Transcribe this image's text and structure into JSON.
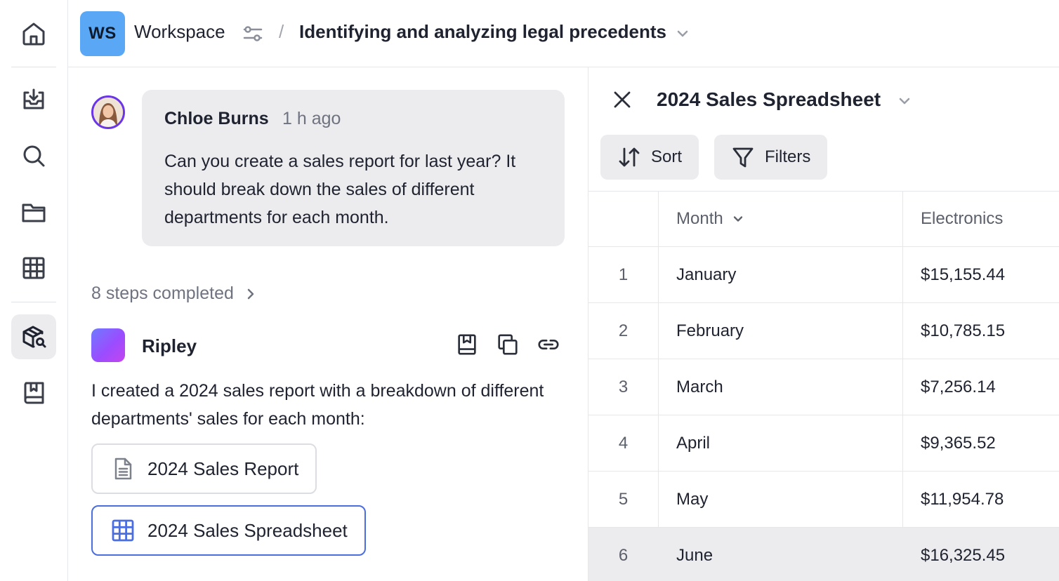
{
  "rail": {
    "items": [
      "home",
      "inbox",
      "search",
      "folders",
      "tables",
      "research",
      "library"
    ],
    "active": "research"
  },
  "topbar": {
    "workspace_badge": "WS",
    "workspace_name": "Workspace",
    "separator": "/",
    "page_title": "Identifying and analyzing legal precedents"
  },
  "chat": {
    "user_message": {
      "author": "Chloe Burns",
      "time": "1 h ago",
      "text": "Can you create a sales report for last year? It should break down the sales of different departments for each month."
    },
    "steps_label": "8 steps completed",
    "assistant": {
      "name": "Ripley",
      "text": "I created a 2024 sales report with a breakdown of different departments' sales for each month:"
    },
    "attachments": [
      {
        "label": "2024 Sales Report",
        "icon": "document-icon"
      },
      {
        "label": "2024 Sales Spreadsheet",
        "icon": "table-icon"
      }
    ]
  },
  "sheet": {
    "title": "2024 Sales Spreadsheet",
    "sort_label": "Sort",
    "filters_label": "Filters",
    "columns": [
      "",
      "Month",
      "Electronics"
    ],
    "rows": [
      {
        "idx": "1",
        "month": "January",
        "electronics": "$15,155.44"
      },
      {
        "idx": "2",
        "month": "February",
        "electronics": "$10,785.15"
      },
      {
        "idx": "3",
        "month": "March",
        "electronics": "$7,256.14"
      },
      {
        "idx": "4",
        "month": "April",
        "electronics": "$9,365.52"
      },
      {
        "idx": "5",
        "month": "May",
        "electronics": "$11,954.78"
      },
      {
        "idx": "6",
        "month": "June",
        "electronics": "$16,325.45"
      }
    ]
  },
  "colors": {
    "accent_border": "#4a6ee0",
    "badge_bg": "#5aa8f5",
    "avatar_ring": "#6b35e8",
    "panel_bg": "#ececef"
  }
}
